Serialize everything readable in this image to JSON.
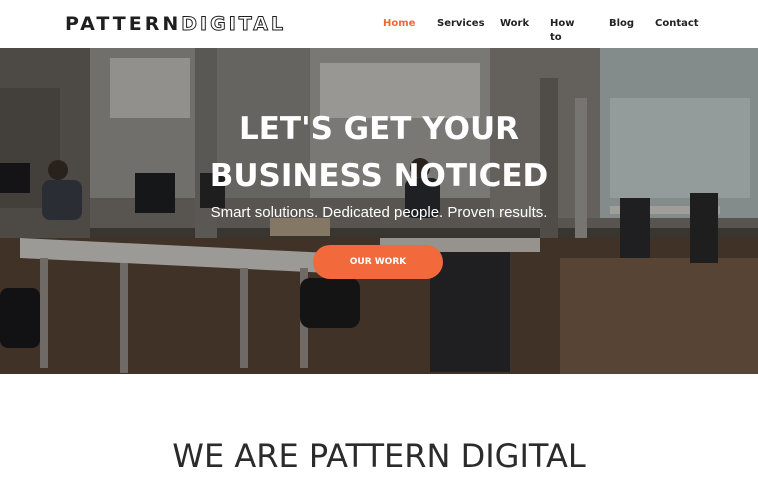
{
  "header": {
    "logo": {
      "part1": "PATTERN",
      "part2": "DIGITAL"
    },
    "nav": [
      {
        "label": "Home",
        "active": true
      },
      {
        "label": "Services",
        "active": false
      },
      {
        "label": "Work",
        "active": false
      },
      {
        "label": "How to",
        "active": false
      },
      {
        "label": "Blog",
        "active": false
      },
      {
        "label": "Contact",
        "active": false
      }
    ]
  },
  "hero": {
    "title_line1": "LET'S GET YOUR",
    "title_line2": "BUSINESS NOTICED",
    "subtitle": "Smart solutions. Dedicated people. Proven results.",
    "button_label": "OUR WORK"
  },
  "about": {
    "title": "WE ARE PATTERN DIGITAL",
    "text": ""
  },
  "colors": {
    "accent": "#f26a3c",
    "nav_active": "#f0683a",
    "text_dark": "#222222"
  }
}
